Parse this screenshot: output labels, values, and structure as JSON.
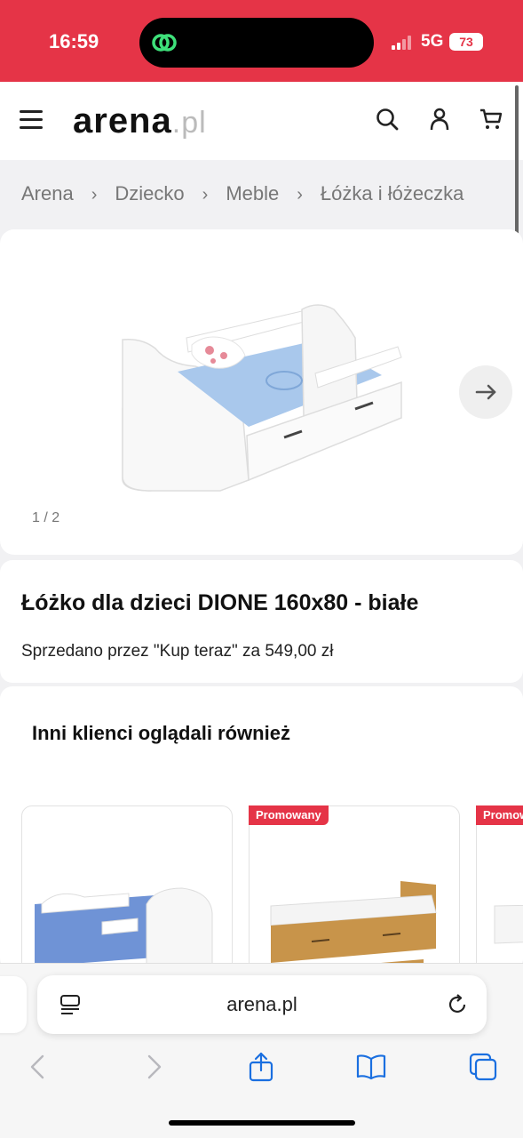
{
  "status_bar": {
    "time": "16:59",
    "network": "5G",
    "battery": "73",
    "colors": {
      "background": "#e53447"
    }
  },
  "header": {
    "logo_main": "arena",
    "logo_tld": ".pl",
    "icons": [
      "menu-icon",
      "search-icon",
      "user-icon",
      "cart-icon"
    ]
  },
  "breadcrumb": {
    "items": [
      "Arena",
      "Dziecko",
      "Meble",
      "Łóżka i łóżeczka"
    ],
    "separator": "›"
  },
  "gallery": {
    "pager": "1 / 2",
    "next_icon": "arrow-right-icon"
  },
  "product": {
    "title": "Łóżko dla dzieci DIONE 160x80 - białe",
    "sold_by": "Sprzedano przez \"Kup teraz\" za 549,00 zł"
  },
  "recommendations": {
    "title": "Inni klienci oglądali również",
    "badge": "Promowany",
    "cards": [
      {
        "promoted": false
      },
      {
        "promoted": true
      },
      {
        "promoted": true
      }
    ]
  },
  "browser": {
    "url": "arena.pl",
    "toolbar_icons": [
      "back-icon",
      "forward-icon",
      "share-icon",
      "bookmarks-icon",
      "tabs-icon"
    ]
  },
  "accent_color": "#e53447"
}
